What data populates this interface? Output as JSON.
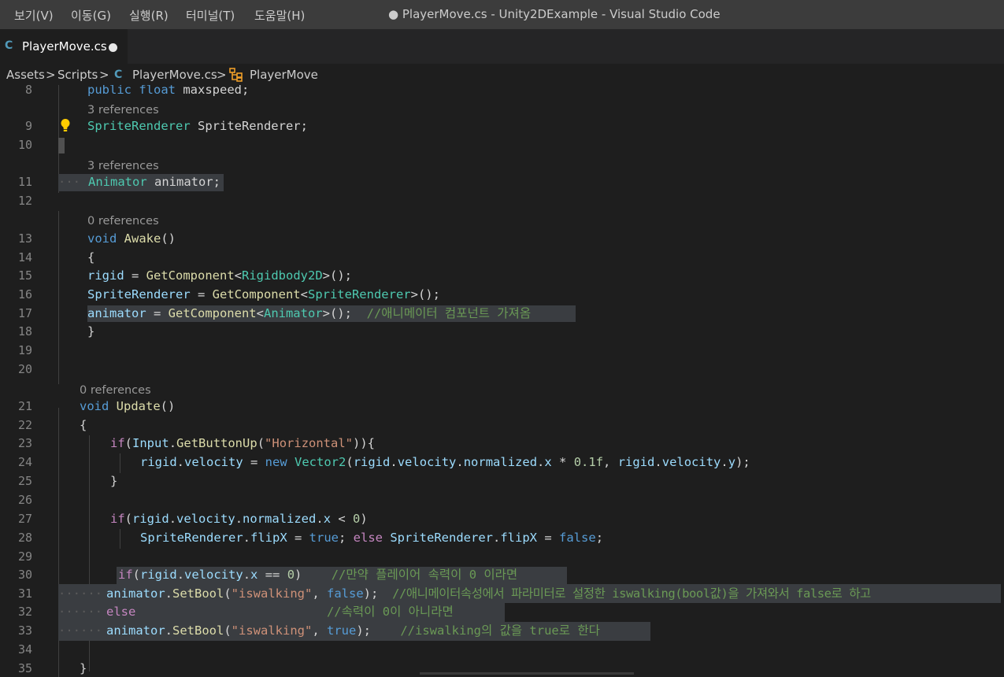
{
  "menu": {
    "items": [
      "보기(V)",
      "이동(G)",
      "실행(R)",
      "터미널(T)",
      "도움말(H)"
    ],
    "window_title": "● PlayerMove.cs - Unity2DExample - Visual Studio Code"
  },
  "tab": {
    "icon": "C",
    "label": "PlayerMove.cs"
  },
  "breadcrumbs": {
    "seg1": "Assets",
    "seg2": "Scripts",
    "seg3": "PlayerMove.cs",
    "seg4": "PlayerMove",
    "sep": ">"
  },
  "editor": {
    "line_numbers": [
      "8",
      "9",
      "10",
      "11",
      "12",
      "13",
      "14",
      "15",
      "16",
      "17",
      "18",
      "19",
      "20",
      "21",
      "22",
      "23",
      "24",
      "25",
      "26",
      "27",
      "28",
      "29",
      "30",
      "31",
      "32",
      "33",
      "34",
      "35"
    ],
    "lenses": {
      "l9": "3 references",
      "l11": "3 references",
      "l13": "0 references",
      "l21": "0 references"
    },
    "colors": {
      "keyword": "#569cd6",
      "control": "#c586c0",
      "type": "#4ec9b0",
      "function": "#dcdcaa",
      "variable": "#9cdcfe",
      "string": "#ce9178",
      "number": "#b5cea8",
      "comment": "#6a9955"
    },
    "code": {
      "l8": {
        "a": "public",
        "b": " ",
        "c": "float",
        "d": " maxspeed;"
      },
      "l9": {
        "a": "SpriteRenderer",
        "b": " SpriteRenderer;"
      },
      "l11": {
        "a": "Animator",
        "b": " animator;"
      },
      "l13": {
        "a": "void",
        "b": " ",
        "c": "Awake",
        "d": "()"
      },
      "l14": {
        "a": "{"
      },
      "l15": {
        "a": "rigid",
        "b": " = ",
        "c": "GetComponent",
        "d": "<",
        "e": "Rigidbody2D",
        "f": ">();"
      },
      "l16": {
        "a": "SpriteRenderer",
        "b": " = ",
        "c": "GetComponent",
        "d": "<",
        "e": "SpriteRenderer",
        "f": ">();"
      },
      "l17": {
        "a": "animator",
        "b": " = ",
        "c": "GetComponent",
        "d": "<",
        "e": "Animator",
        "f": ">();",
        "g": "  //애니메이터 컴포넌트 가져옴"
      },
      "l18": {
        "a": "}"
      },
      "l21": {
        "a": "void",
        "b": " ",
        "c": "Update",
        "d": "()"
      },
      "l22": {
        "a": "{"
      },
      "l23": {
        "a": "if",
        "b": "(",
        "c": "Input",
        "d": ".",
        "e": "GetButtonUp",
        "f": "(",
        "g": "\"Horizontal\"",
        "h": ")){"
      },
      "l24": {
        "a": "rigid",
        "b": ".",
        "c": "velocity",
        "d": " = ",
        "e": "new",
        "f": " ",
        "g": "Vector2",
        "h": "(",
        "i": "rigid",
        "j": ".",
        "k": "velocity",
        "l": ".",
        "m": "normalized",
        "n": ".",
        "o": "x",
        "p": " * ",
        "q": "0.1f",
        "r": ", ",
        "s": "rigid",
        "t": ".",
        "u": "velocity",
        "v": ".",
        "w": "y",
        "x": ");"
      },
      "l25": {
        "a": "}"
      },
      "l27": {
        "a": "if",
        "b": "(",
        "c": "rigid",
        "d": ".",
        "e": "velocity",
        "f": ".",
        "g": "normalized",
        "h": ".",
        "i": "x",
        "j": " < ",
        "k": "0",
        "l": ")"
      },
      "l28": {
        "a": "SpriteRenderer",
        "b": ".",
        "c": "flipX",
        "d": " = ",
        "e": "true",
        "f": "; ",
        "g": "else",
        "h": " ",
        "i": "SpriteRenderer",
        "j": ".",
        "k": "flipX",
        "l": " = ",
        "m": "false",
        "n": ";"
      },
      "l30": {
        "a": "if",
        "b": "(",
        "c": "rigid",
        "d": ".",
        "e": "velocity",
        "f": ".",
        "g": "x",
        "h": " == ",
        "i": "0",
        "j": ")",
        "k": "    //만약 플레이어 속력이 0 이라면"
      },
      "l31": {
        "ws": "······",
        "a": "animator",
        "b": ".",
        "c": "SetBool",
        "d": "(",
        "e": "\"iswalking\"",
        "f": ", ",
        "g": "false",
        "h": ");",
        "i": "  //애니메이터속성에서 파라미터로 설정한 iswalking(bool값)을 가져와서 false로 하고"
      },
      "l32": {
        "ws": "······",
        "a": "else",
        "b": "                          ",
        "c": "//속력이 0이 아니라면"
      },
      "l33": {
        "ws": "······",
        "a": "animator",
        "b": ".",
        "c": "SetBool",
        "d": "(",
        "e": "\"iswalking\"",
        "f": ", ",
        "g": "true",
        "h": ");",
        "i": "    //iswalking의 값을 true로 한다"
      },
      "l35": {
        "a": "}"
      }
    }
  }
}
